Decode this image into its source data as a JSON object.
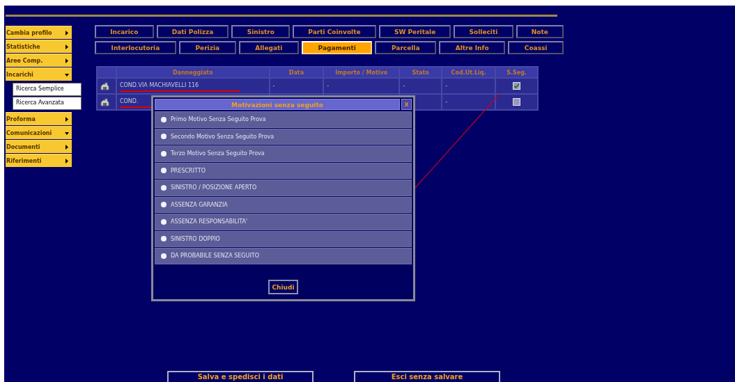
{
  "sidebar": {
    "items": [
      {
        "label": "Cambia profilo",
        "expanded": false
      },
      {
        "label": "Statistiche",
        "expanded": false
      },
      {
        "label": "Aree Comp.",
        "expanded": false
      },
      {
        "label": "Incarichi",
        "expanded": true,
        "children": [
          {
            "label": "Ricerca Semplice"
          },
          {
            "label": "Ricerca Avanzata"
          }
        ]
      },
      {
        "label": "Proforma",
        "expanded": false
      },
      {
        "label": "Comunicazioni",
        "expanded": true
      },
      {
        "label": "Documenti",
        "expanded": false
      },
      {
        "label": "Riferimenti",
        "expanded": false
      }
    ]
  },
  "tabs": [
    [
      {
        "label": "Incarico",
        "selected": false
      },
      {
        "label": "Dati Polizza",
        "selected": false
      },
      {
        "label": "Sinistro",
        "selected": false
      },
      {
        "label": "Parti Coinvolte",
        "selected": false
      },
      {
        "label": "SW Peritale",
        "selected": false
      },
      {
        "label": "Solleciti",
        "selected": false
      },
      {
        "label": "Note",
        "selected": false
      }
    ],
    [
      {
        "label": "Interlocutoria",
        "selected": false
      },
      {
        "label": "Perizia",
        "selected": false
      },
      {
        "label": "Allegati",
        "selected": false
      },
      {
        "label": "Pagamenti",
        "selected": true
      },
      {
        "label": "Parcella",
        "selected": false
      },
      {
        "label": "Altre Info",
        "selected": false
      },
      {
        "label": "Coassi",
        "selected": false
      }
    ]
  ],
  "table": {
    "columns": [
      "Danneggiato",
      "Data",
      "Importo / Motivo",
      "Stato",
      "Cod.Ut.Liq.",
      "S.Seg."
    ],
    "rows": [
      {
        "danneggiato": "COND.VIA MACHIAVELLI 116",
        "struck": true,
        "data": "-",
        "importo": "-",
        "stato": "-",
        "cod": "-",
        "checked": true
      },
      {
        "danneggiato": "COND.",
        "struck": true,
        "cod": "-",
        "checked": false
      }
    ]
  },
  "dialog": {
    "title": "Motivazioni senza seguito",
    "close": "X",
    "pointer_line": true,
    "options": [
      {
        "label": "Primo Motivo Senza Seguito Prova",
        "selected": false
      },
      {
        "label": "Secondo Motivo Senza Seguito Prova",
        "selected": false
      },
      {
        "label": "Terzo Motivo Senza Seguito Prova",
        "selected": false
      },
      {
        "label": "PRESCRITTO",
        "selected": false
      },
      {
        "label": "SINISTRO / POSIZIONE APERTO",
        "selected": false
      },
      {
        "label": "ASSENZA GARANZIA",
        "selected": false
      },
      {
        "label": "ASSENZA RESPONSABILITA'",
        "selected": false
      },
      {
        "label": "SINISTRO DOPPIO",
        "selected": false
      },
      {
        "label": "DA PROBABILE SENZA SEGUITO",
        "selected": false
      }
    ],
    "button": "Chiudi"
  },
  "buttons": [
    "Salva e spedisci i dati",
    "Esci senza salvare"
  ]
}
